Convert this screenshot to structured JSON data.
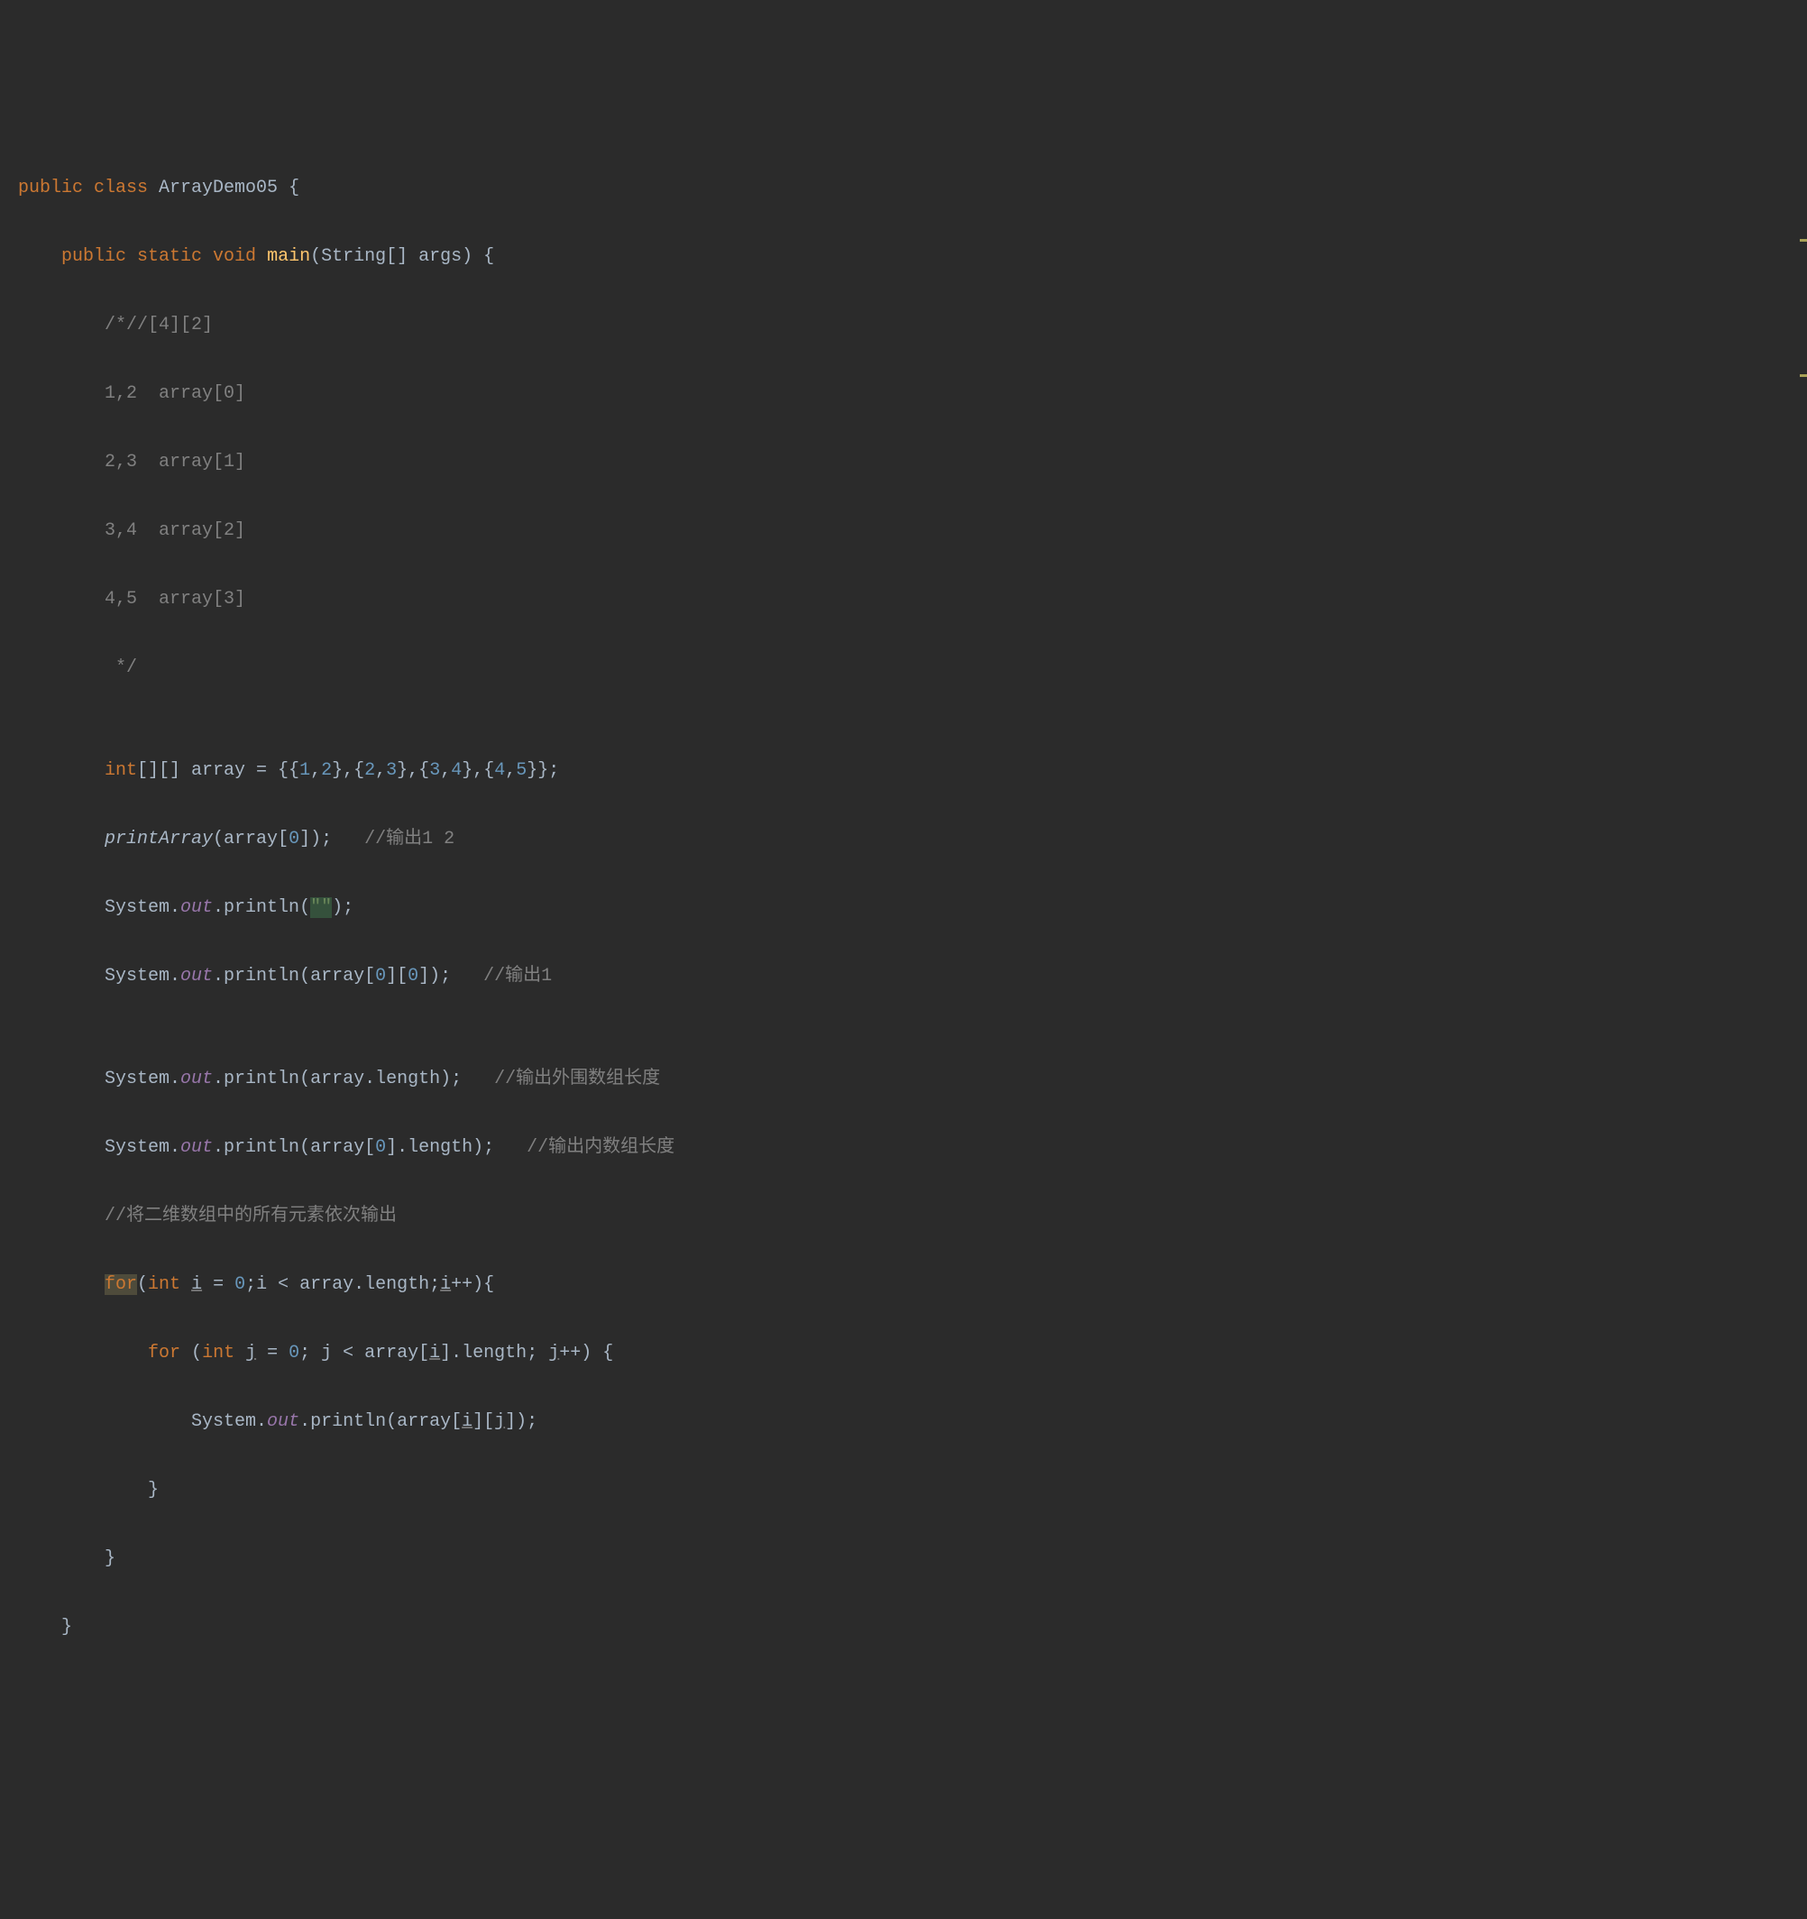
{
  "code": {
    "l1": {
      "kw1": "public class ",
      "cls": "ArrayDemo05 ",
      "brace": "{"
    },
    "l2": {
      "indent": "    ",
      "kw1": "public static void ",
      "m": "main",
      "params": "(String[] args) {"
    },
    "l3": {
      "indent": "        ",
      "c": "/*//[4][2]"
    },
    "l4": {
      "indent": "        ",
      "c": "1,2  array[0]"
    },
    "l5": {
      "indent": "        ",
      "c": "2,3  array[1]"
    },
    "l6": {
      "indent": "        ",
      "c": "3,4  array[2]"
    },
    "l7": {
      "indent": "        ",
      "c": "4,5  array[3]"
    },
    "l8": {
      "indent": "         ",
      "c": "*/"
    },
    "l9": {
      "indent": ""
    },
    "l10": {
      "indent": "        ",
      "kw": "int",
      "rest1": "[][] array = {{",
      "n1": "1",
      "c1": ",",
      "n2": "2",
      "b1": "},{",
      "n3": "2",
      "c2": ",",
      "n4": "3",
      "b2": "},{",
      "n5": "3",
      "c3": ",",
      "n6": "4",
      "b3": "},{",
      "n7": "4",
      "c4": ",",
      "n8": "5",
      "end": "}};"
    },
    "l11": {
      "indent": "        ",
      "call": "printArray",
      "args1": "(array[",
      "n": "0",
      "args2": "]);   ",
      "c": "//输出1 2"
    },
    "l12": {
      "indent": "        ",
      "sys": "System.",
      "out": "out",
      "dot": ".println(",
      "str": "\"\"",
      "end": ");"
    },
    "l13": {
      "indent": "        ",
      "sys": "System.",
      "out": "out",
      "dot": ".println(array[",
      "n1": "0",
      "mid": "][",
      "n2": "0",
      "end": "]);   ",
      "c": "//输出1"
    },
    "l14": {
      "indent": ""
    },
    "l15": {
      "indent": "        ",
      "sys": "System.",
      "out": "out",
      "dot": ".println(array.length);   ",
      "c": "//输出外围数组长度"
    },
    "l16": {
      "indent": "        ",
      "sys": "System.",
      "out": "out",
      "dot": ".println(array[",
      "n": "0",
      "end": "].length);   ",
      "c": "//输出内数组长度"
    },
    "l17": {
      "indent": "        ",
      "c": "//将二维数组中的所有元素依次输出"
    },
    "l18": {
      "indent": "        ",
      "for": "for",
      "p1": "(",
      "kw": "int ",
      "v": "i",
      "eq": " = ",
      "n1": "0",
      "semi": ";i < array.length;",
      "inc": "i",
      "pp": "++){"
    },
    "l19": {
      "indent": "            ",
      "for": "for ",
      "p1": "(",
      "kw": "int ",
      "v": "j",
      "eq": " = ",
      "n1": "0",
      "semi": "; j < array[",
      "iv": "i",
      "end1": "].length; ",
      "inc": "j",
      "pp": "++) {"
    },
    "l20": {
      "indent": "                ",
      "sys": "System.",
      "out": "out",
      "dot": ".println(array[",
      "iv": "i",
      "mid": "][",
      "jv": "j",
      "end": "]);"
    },
    "l21": {
      "indent": "            ",
      "brace": "}"
    },
    "l22": {
      "indent": "        ",
      "brace": "}"
    },
    "l23": {
      "indent": "    ",
      "brace": "}"
    }
  }
}
